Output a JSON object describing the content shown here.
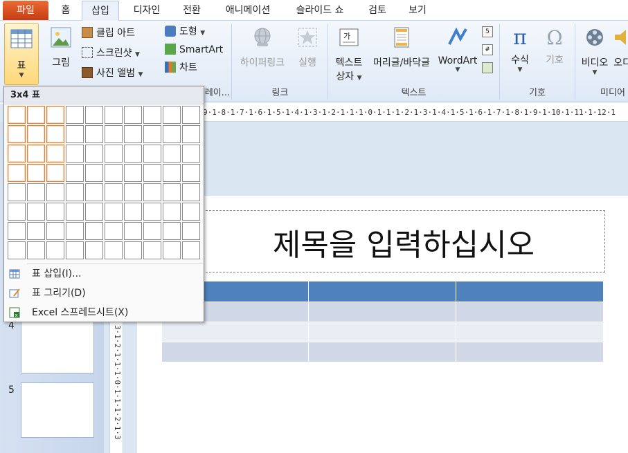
{
  "tabs": [
    {
      "label": "파일"
    },
    {
      "label": "홈"
    },
    {
      "label": "삽입"
    },
    {
      "label": "디자인"
    },
    {
      "label": "전환"
    },
    {
      "label": "애니메이션"
    },
    {
      "label": "슬라이드 쇼"
    },
    {
      "label": "검토"
    },
    {
      "label": "보기"
    }
  ],
  "ribbon": {
    "table_btn": "표",
    "picture_btn": "그림",
    "clipart_btn": "클립 아트",
    "screenshot_btn": "스크린샷",
    "album_btn": "사진 앨범",
    "shapes_btn": "도형",
    "smartart_btn": "SmartArt",
    "chart_btn": "차트",
    "hyperlink_btn": "하이퍼링크",
    "action_btn": "실행",
    "textbox_btn_l1": "텍스트",
    "textbox_btn_l2": "상자",
    "headerfooter_btn": "머리글/바닥글",
    "wordart_btn": "WordArt",
    "equation_btn": "수식",
    "symbol_btn": "기호",
    "video_btn": "비디오",
    "audio_btn": "오디",
    "groups": {
      "illustrations": "레이...",
      "links": "링크",
      "text": "텍스트",
      "symbols": "기호",
      "media": "미디어"
    }
  },
  "ruler": {
    "h_text": "9·1·8·1·7·1·6·1·5·1·4·1·3·1·2·1·1·1·0·1·1·1·2·1·3·1·4·1·5·1·6·1·7·1·8·1·9·1·10·1·11·1·12·1",
    "v_text": "3·1·2·1·1·1·0·1·1·1·2·1·3"
  },
  "slides_pane": {
    "items": [
      {
        "num": "4"
      },
      {
        "num": "5"
      }
    ]
  },
  "slide": {
    "title": "제목을 입력하십시오",
    "table_colors": {
      "header": "#4f81bd",
      "odd": "#d0d8e8",
      "even": "#e9edf4"
    }
  },
  "table_dropdown": {
    "header": "3x4 표",
    "grid_cols": 10,
    "grid_rows": 8,
    "selected_cols": 3,
    "selected_rows": 4,
    "menu": [
      {
        "label": "표 삽입(I)...",
        "icon": "table-insert-icon"
      },
      {
        "label": "표 그리기(D)",
        "icon": "pencil-table-icon"
      },
      {
        "label": "Excel 스프레드시트(X)",
        "icon": "excel-sheet-icon"
      }
    ]
  }
}
